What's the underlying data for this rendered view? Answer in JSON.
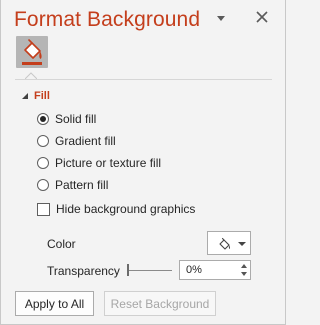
{
  "pane": {
    "title": "Format Background",
    "tab_fill_icon": "paint-bucket-icon",
    "accent_color": "#c43e1c"
  },
  "fill_section": {
    "label": "Fill",
    "options": [
      {
        "label": "Solid fill",
        "checked": true
      },
      {
        "label": "Gradient fill",
        "checked": false
      },
      {
        "label": "Picture or texture fill",
        "checked": false
      },
      {
        "label": "Pattern fill",
        "checked": false
      }
    ],
    "hide_background_graphics": {
      "label": "Hide background graphics",
      "checked": false
    },
    "color": {
      "label": "Color",
      "icon": "paint-bucket-icon"
    },
    "transparency": {
      "label": "Transparency",
      "value": "0%",
      "percent": 0
    }
  },
  "footer": {
    "apply_to_all": "Apply to All",
    "reset_background": "Reset Background"
  }
}
